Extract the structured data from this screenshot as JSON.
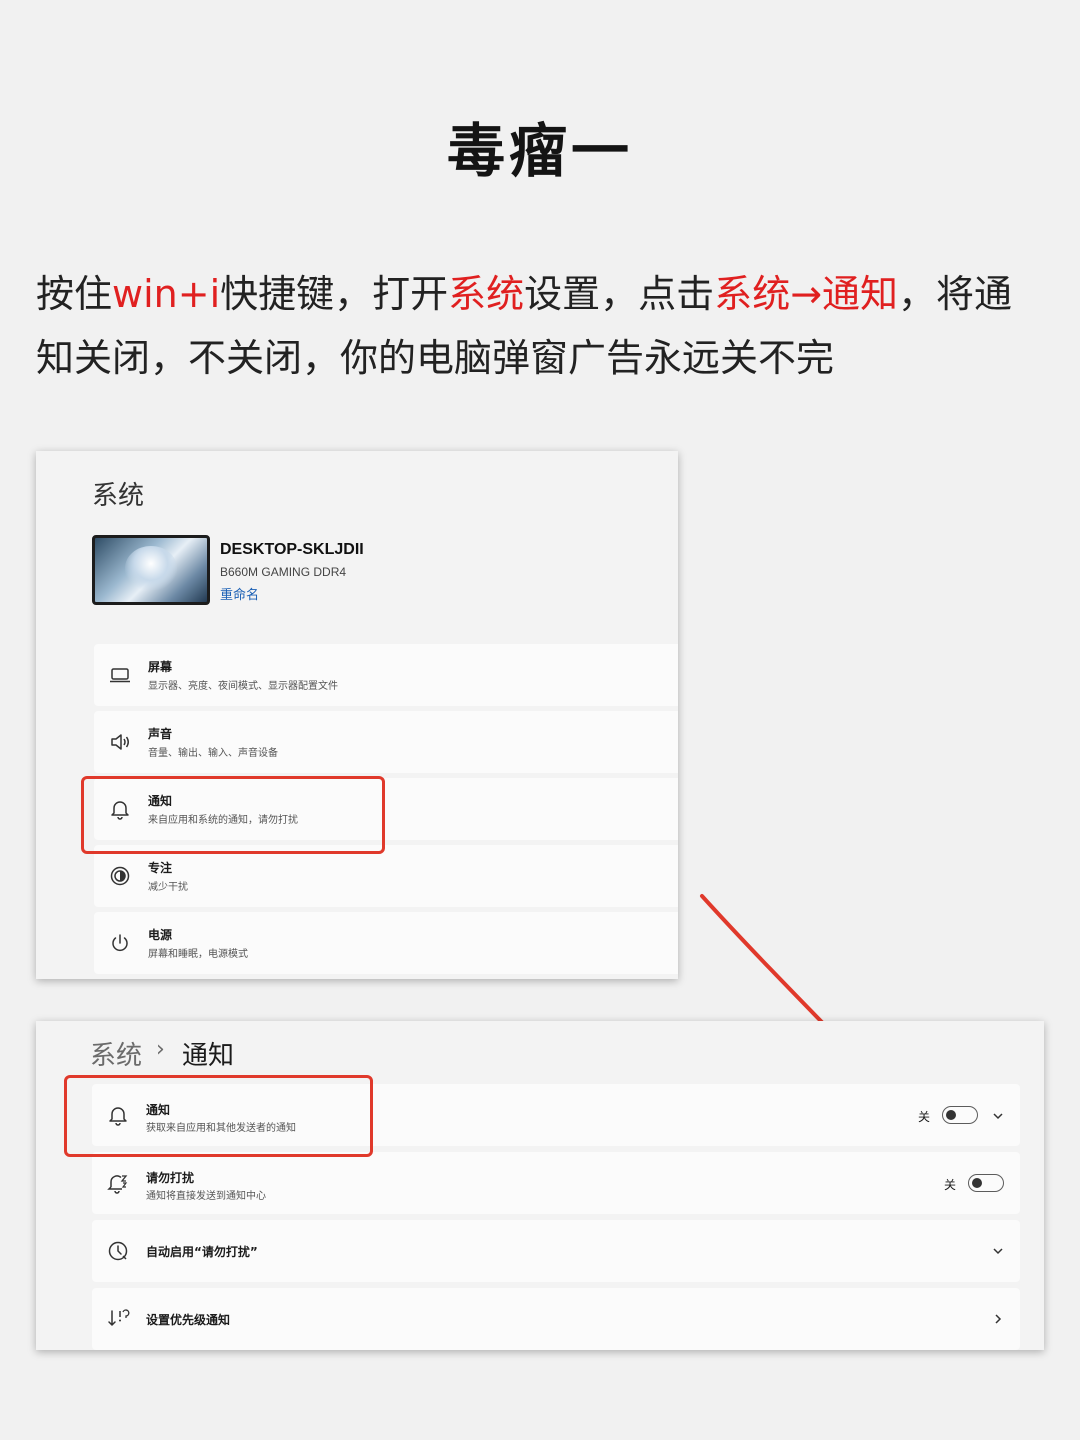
{
  "header": {
    "title": "毒瘤一"
  },
  "intro": {
    "part1": "按住",
    "win_key": "win+i",
    "part2": "快捷键，打开",
    "system_hl": "系统",
    "part3": "设置，点击",
    "path_hl": "系统→通知",
    "part4": "，将通知关闭，不关闭，你的电脑弹窗广告永远关不完"
  },
  "colors": {
    "highlight": "#e02020",
    "annotation_red": "#e0392b",
    "link_blue": "#1a5fb4"
  },
  "panel_system": {
    "heading": "系统",
    "device": {
      "name": "DESKTOP-SKLJDII",
      "model": "B660M GAMING DDR4",
      "rename": "重命名"
    },
    "items": [
      {
        "title": "屏幕",
        "subtitle": "显示器、亮度、夜间模式、显示器配置文件",
        "icon": "display-icon"
      },
      {
        "title": "声音",
        "subtitle": "音量、输出、输入、声音设备",
        "icon": "speaker-icon"
      },
      {
        "title": "通知",
        "subtitle": "来自应用和系统的通知，请勿打扰",
        "icon": "bell-icon"
      },
      {
        "title": "专注",
        "subtitle": "减少干扰",
        "icon": "focus-icon"
      },
      {
        "title": "电源",
        "subtitle": "屏幕和睡眠，电源模式",
        "icon": "power-icon"
      }
    ]
  },
  "panel_notifications": {
    "breadcrumb": {
      "parent": "系统",
      "separator": "›",
      "current": "通知"
    },
    "items": [
      {
        "title": "通知",
        "subtitle": "获取来自应用和其他发送者的通知",
        "toggle_label": "关",
        "toggle_on": false,
        "icon": "bell-icon"
      },
      {
        "title": "请勿打扰",
        "subtitle": "通知将直接发送到通知中心",
        "toggle_label": "关",
        "toggle_on": false,
        "icon": "bell-snooze-icon"
      },
      {
        "title": "自动启用“请勿打扰”",
        "icon": "clock-icon"
      },
      {
        "title": "设置优先级通知",
        "icon": "priority-icon"
      }
    ]
  }
}
